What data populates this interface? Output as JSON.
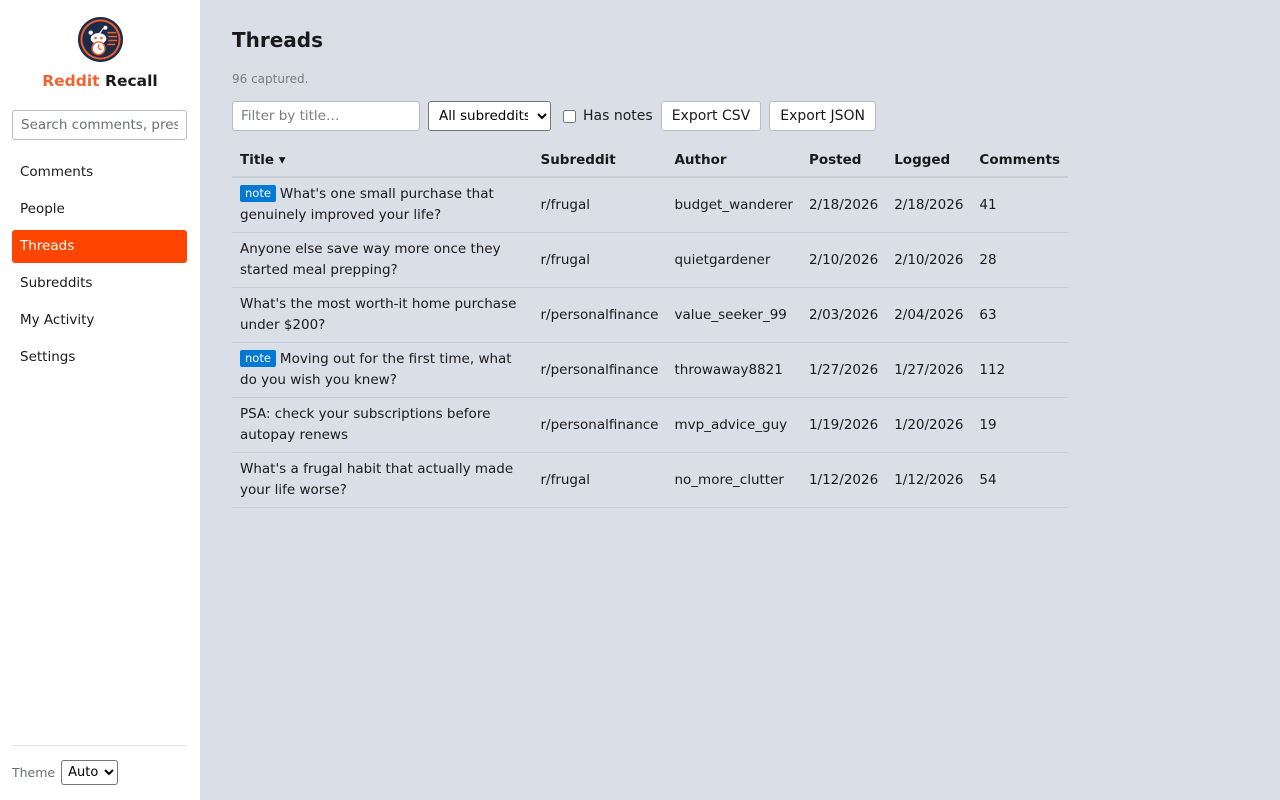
{
  "app": {
    "brand_part1": "Reddit",
    "brand_part2": "Recall",
    "brand_color": "#f06330",
    "accent_color": "#ff4500"
  },
  "sidebar": {
    "search_placeholder": "Search comments, press /",
    "items": [
      {
        "label": "Comments",
        "active": false
      },
      {
        "label": "People",
        "active": false
      },
      {
        "label": "Threads",
        "active": true
      },
      {
        "label": "Subreddits",
        "active": false
      },
      {
        "label": "My Activity",
        "active": false
      },
      {
        "label": "Settings",
        "active": false
      }
    ],
    "theme_label": "Theme",
    "theme_value": "Auto"
  },
  "main": {
    "title": "Threads",
    "subtitle": "96 captured.",
    "filter_placeholder": "Filter by title…",
    "subreddit_select": "All subreddits",
    "has_notes_label": "Has notes",
    "export_csv": "Export CSV",
    "export_json": "Export JSON",
    "note_badge": "note",
    "columns": {
      "title": "Title ▾",
      "subreddit": "Subreddit",
      "author": "Author",
      "posted": "Posted",
      "logged": "Logged",
      "comments": "Comments"
    },
    "rows": [
      {
        "note": true,
        "title": "What's one small purchase that genuinely improved your life?",
        "subreddit": "r/frugal",
        "author": "budget_wanderer",
        "posted": "2/18/2026",
        "logged": "2/18/2026",
        "comments": "41"
      },
      {
        "note": false,
        "title": "Anyone else save way more once they started meal prepping?",
        "subreddit": "r/frugal",
        "author": "quietgardener",
        "posted": "2/10/2026",
        "logged": "2/10/2026",
        "comments": "28"
      },
      {
        "note": false,
        "title": "What's the most worth-it home purchase under $200?",
        "subreddit": "r/personalfinance",
        "author": "value_seeker_99",
        "posted": "2/03/2026",
        "logged": "2/04/2026",
        "comments": "63"
      },
      {
        "note": true,
        "title": "Moving out for the first time, what do you wish you knew?",
        "subreddit": "r/personalfinance",
        "author": "throwaway8821",
        "posted": "1/27/2026",
        "logged": "1/27/2026",
        "comments": "112"
      },
      {
        "note": false,
        "title": "PSA: check your subscriptions before autopay renews",
        "subreddit": "r/personalfinance",
        "author": "mvp_advice_guy",
        "posted": "1/19/2026",
        "logged": "1/20/2026",
        "comments": "19"
      },
      {
        "note": false,
        "title": "What's a frugal habit that actually made your life worse?",
        "subreddit": "r/frugal",
        "author": "no_more_clutter",
        "posted": "1/12/2026",
        "logged": "1/12/2026",
        "comments": "54"
      }
    ]
  }
}
